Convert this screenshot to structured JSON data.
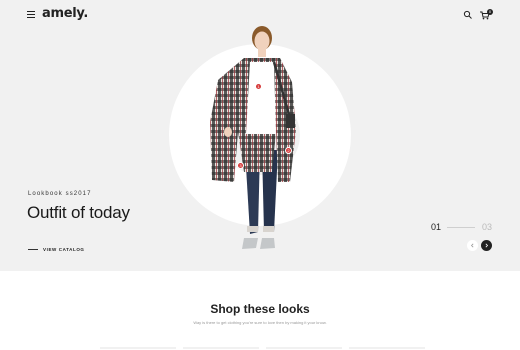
{
  "header": {
    "logo": "amely.",
    "icons": [
      "menu-icon",
      "search-icon",
      "cart-icon"
    ],
    "cart_count": "0"
  },
  "hero": {
    "subtitle": "Lookbook ss2017",
    "title": "Outfit of today",
    "cta": "VIEW CATALOG",
    "pagination": {
      "current": "01",
      "total": "03"
    },
    "hotspots": [
      "1",
      "2",
      "3"
    ],
    "colors": {
      "background": "#f1f1f1",
      "hotspot": "#d63a3a",
      "ring": "#ffffff"
    }
  },
  "shop": {
    "title": "Shop these looks",
    "subtitle": "Way is there to get clothing you're sure to love then by making it your know."
  }
}
